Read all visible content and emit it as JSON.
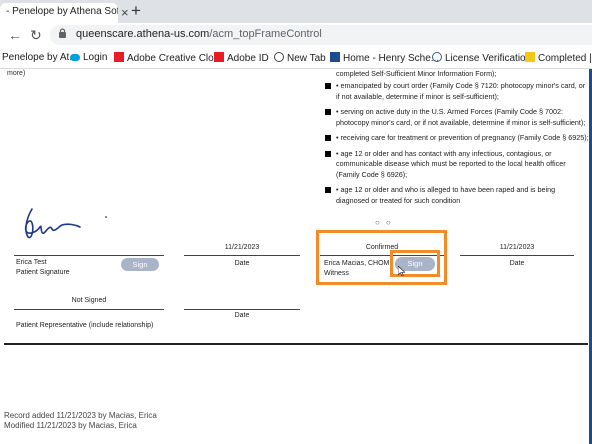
{
  "browser": {
    "tab_title": "- Penelope by Athena Softw",
    "tab_close": "×",
    "new_tab": "+",
    "url_host": "queenscare.athena-us.com",
    "url_path": "/acm_topFrameControl"
  },
  "bookmarks": [
    {
      "label": "Penelope by At...",
      "icon": "athena-icon",
      "color": "#555555"
    },
    {
      "label": "Login",
      "icon": "cloud-icon",
      "color": "#00a1e0"
    },
    {
      "label": "Adobe Creative Clo...",
      "icon": "adobe-icon",
      "color": "#e81c24"
    },
    {
      "label": "Adobe ID",
      "icon": "adobe-icon",
      "color": "#e81c24"
    },
    {
      "label": "New Tab",
      "icon": "globe-icon",
      "color": "#444444"
    },
    {
      "label": "Home - Henry Sche...",
      "icon": "henry-schein-icon",
      "color": "#1a4c8f"
    },
    {
      "label": "License Verification",
      "icon": "license-icon",
      "color": "#3b5998"
    },
    {
      "label": "Completed | Do",
      "icon": "download-icon",
      "color": "#f5c518"
    }
  ],
  "form": {
    "more_text": "more)",
    "top_line": "completed Self-Sufficient Minor Information Form);",
    "list_items": [
      "• emancipated by court order (Family Code § 7120: photocopy minor's card, or if not available, determine if minor is self-sufficient);",
      "• serving on active duty in the U.S. Armed Forces (Family Code § 7002: photocopy minor's card, or if not available, determine if minor is self-sufficient);",
      "• receiving care for treatment or prevention of pregnancy (Family Code § 6925);",
      "• age 12 or older and has contact with any infectious, contagious, or communicable disease which must be reported to the local health officer (Family Code § 6926);",
      "• age 12 or older and who is alleged to have been raped and is being diagnosed or treated for such condition"
    ],
    "dots": "○○",
    "patient": {
      "name": "Erica Test",
      "role": "Patient Signature",
      "sign_label": "Sign",
      "date_value": "11/21/2023",
      "date_label": "Date"
    },
    "witness": {
      "status": "Confirmed",
      "name": "Erica Macias, CHOM",
      "role": "Witness",
      "sign_label": "Sign",
      "date_value": "11/21/2023",
      "date_label": "Date"
    },
    "representative": {
      "status": "Not Signed",
      "role": "Patient Representative (include relationship)",
      "date_label": "Date"
    }
  },
  "footer": {
    "record_added": "Record added 11/21/2023 by Macias, Erica",
    "modified": "Modified 11/21/2023 by Macias, Erica"
  },
  "colors": {
    "highlight": "#f28c28",
    "sign_button": "#a9b4c8"
  }
}
